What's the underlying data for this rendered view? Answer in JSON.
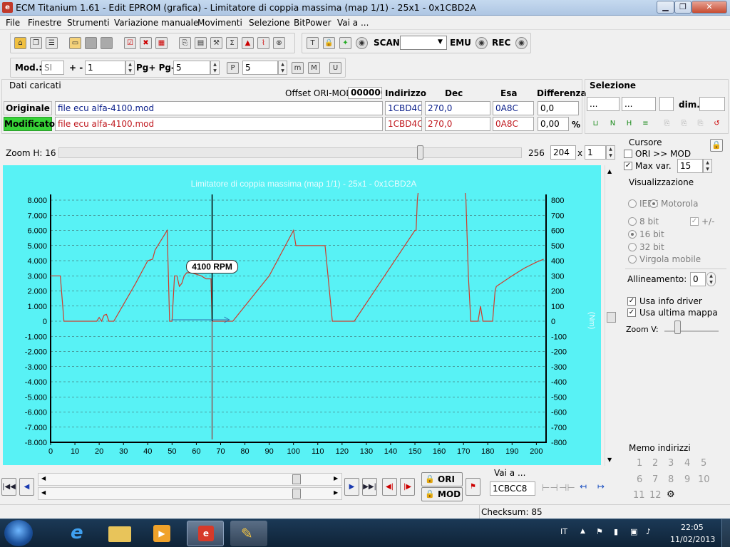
{
  "window": {
    "title": "ECM Titanium 1.61 - Edit EPROM (grafica) - Limitatore di coppia massima (map 1/1) - 25x1 - 0x1CBD2A",
    "app_icon": "ecm-icon"
  },
  "menu": [
    "File",
    "Finestre",
    "Strumenti",
    "Variazione manuale",
    "Movimenti",
    "Selezione",
    "BitPower",
    "Vai a ..."
  ],
  "toolbar": {
    "scan_label": "SCAN",
    "emu_label": "EMU",
    "rec_label": "REC",
    "scan_select": ""
  },
  "toolbar2": {
    "mod_label": "Mod.:",
    "mod_value": "SI",
    "plusminus_label": "+ -",
    "plusminus_value": "1",
    "pg_label": "Pg+ Pg-",
    "pg_value": "5",
    "p_value": "5"
  },
  "dati": {
    "title": "Dati caricati",
    "offset_label": "Offset ORI-MOD",
    "offset_value": "000000",
    "headers": {
      "indirizzo": "Indirizzo",
      "dec": "Dec",
      "esa": "Esa",
      "differenza": "Differenza"
    },
    "originale": {
      "label": "Originale",
      "file": "file ecu alfa-4100.mod",
      "indirizzo": "1CBD4C",
      "dec": "270,0",
      "esa": "0A8C",
      "differenza": "0,0"
    },
    "modificato": {
      "label": "Modificato",
      "file": "file ecu alfa-4100.mod",
      "indirizzo": "1CBD4C",
      "dec": "270,0",
      "esa": "0A8C",
      "differenza": "0,00",
      "percent": "%"
    }
  },
  "selezione": {
    "title": "Selezione",
    "field1": "...",
    "field2": "...",
    "dim_label": "dim."
  },
  "zoom": {
    "label": "Zoom H: 16",
    "value": "256",
    "w": "204",
    "x_label": "x",
    "h": "1",
    "slider_level": 0.7
  },
  "cursore": {
    "title": "Cursore",
    "ori_mod_label": "ORI >> MOD",
    "max_var_label": "Max var.",
    "max_var_value": "15",
    "ori_mod_checked": false,
    "max_var_checked": true
  },
  "visualizzazione": {
    "title": "Visualizzazione",
    "ieee": "IEEE",
    "motorola": "Motorola",
    "bit8": "8 bit",
    "plusminus": "+/-",
    "bit16": "16 bit",
    "bit32": "32 bit",
    "virgola": "Virgola mobile",
    "allineamento_label": "Allineamento:",
    "allineamento_value": "0",
    "usa_info_driver": "Usa info driver",
    "usa_ultima_mappa": "Usa ultima mappa",
    "zoom_v": "Zoom V:"
  },
  "chart_data": {
    "type": "line",
    "title": "Limitatore di coppia massima (map 1/1) - 25x1 - 0x1CBD2A",
    "xlabel": "",
    "ylabel_right": "(Nm)",
    "xlim": [
      0,
      204
    ],
    "ylim": [
      -8000,
      8000
    ],
    "ylim_right": [
      -800,
      800
    ],
    "x_ticks": [
      0,
      10,
      20,
      30,
      40,
      50,
      60,
      70,
      80,
      90,
      100,
      110,
      120,
      130,
      140,
      150,
      160,
      170,
      180,
      190,
      200
    ],
    "y_ticks_left": [
      "8.000",
      "7.000",
      "6.000",
      "5.000",
      "4.000",
      "3.000",
      "2.000",
      "1.000",
      "0",
      "-1.000",
      "-2.000",
      "-3.000",
      "-4.000",
      "-5.000",
      "-6.000",
      "-7.000",
      "-8.000"
    ],
    "y_ticks_right": [
      "800",
      "700",
      "600",
      "500",
      "400",
      "300",
      "200",
      "100",
      "0",
      "-100",
      "-200",
      "-300",
      "-400",
      "-500",
      "-600",
      "-700",
      "-800"
    ],
    "cursor_x": 66.5,
    "cursor_label": "4100 RPM",
    "series": [
      {
        "color": "#d03c2c",
        "points": [
          [
            0,
            3000
          ],
          [
            4,
            3000
          ],
          [
            5.5,
            0
          ],
          [
            19,
            0
          ],
          [
            20,
            250
          ],
          [
            21,
            0
          ],
          [
            22,
            400
          ],
          [
            23,
            450
          ],
          [
            24,
            0
          ],
          [
            26,
            0
          ],
          [
            35,
            2500
          ],
          [
            40,
            4000
          ],
          [
            42,
            4100
          ],
          [
            43,
            4700
          ],
          [
            48,
            6000
          ],
          [
            49,
            0
          ],
          [
            50,
            0
          ],
          [
            51,
            3000
          ],
          [
            52,
            3000
          ],
          [
            53,
            2300
          ],
          [
            54,
            2500
          ],
          [
            55,
            3000
          ],
          [
            56,
            3200
          ],
          [
            58,
            3200
          ],
          [
            60,
            3100
          ],
          [
            62,
            3000
          ],
          [
            64,
            2800
          ],
          [
            66,
            2800
          ],
          [
            66.5,
            0
          ],
          [
            75,
            0
          ],
          [
            90,
            3000
          ],
          [
            100,
            6000
          ],
          [
            101,
            5000
          ],
          [
            113,
            5000
          ],
          [
            116,
            0
          ],
          [
            125,
            0
          ],
          [
            150,
            6000
          ],
          [
            150.5,
            6000
          ],
          [
            151,
            8000
          ],
          [
            152,
            9500
          ],
          [
            170,
            9500
          ],
          [
            171,
            8000
          ],
          [
            172,
            3000
          ],
          [
            173,
            0
          ],
          [
            176,
            0
          ],
          [
            177,
            1000
          ],
          [
            178,
            0
          ],
          [
            179,
            0
          ],
          [
            182,
            0
          ],
          [
            183,
            2000
          ],
          [
            183.5,
            2300
          ],
          [
            190,
            3000
          ],
          [
            195,
            3500
          ],
          [
            200,
            3900
          ],
          [
            203,
            4100
          ]
        ]
      }
    ]
  },
  "nav": {
    "ori_label": "ORI",
    "mod_label": "MOD",
    "vai_label": "Vai a ...",
    "vai_value": "1CBCC8"
  },
  "memo": {
    "title": "Memo indirizzi",
    "items": [
      "1",
      "2",
      "3",
      "4",
      "5",
      "6",
      "7",
      "8",
      "9",
      "10",
      "11",
      "12"
    ]
  },
  "status": {
    "checksum": "Checksum: 85"
  },
  "taskbar": {
    "lang": "IT",
    "time": "22:05",
    "date": "11/02/2013"
  }
}
